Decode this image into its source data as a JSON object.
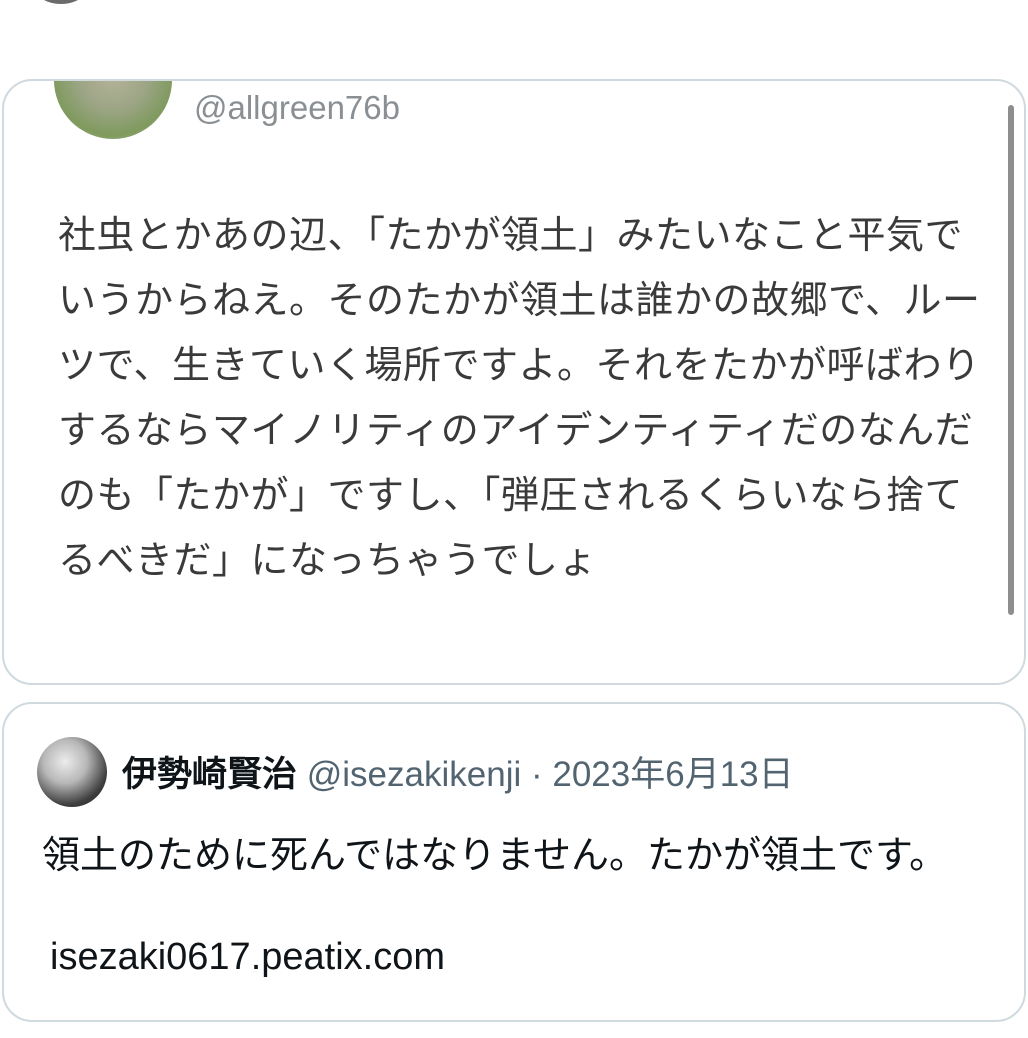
{
  "quoted": {
    "handle": "@allgreen76b",
    "text": "社虫とかあの辺、「たかが領土」みたいなこと平気でいうからねえ。そのたかが領土は誰かの故郷で、ルーツで、生きていく場所ですよ。それをたかが呼ばわりするならマイノリティのアイデンティティだのなんだのも「たかが」ですし、「弾圧されるくらいなら捨てるべきだ」になっちゃうでしょ"
  },
  "tweet": {
    "name": "伊勢崎賢治",
    "handle": "@isezakikenji",
    "separator": "·",
    "date": "2023年6月13日",
    "text": "領土のために死んではなりません。たかが領土です。",
    "link": "isezaki0617.peatix.com"
  }
}
